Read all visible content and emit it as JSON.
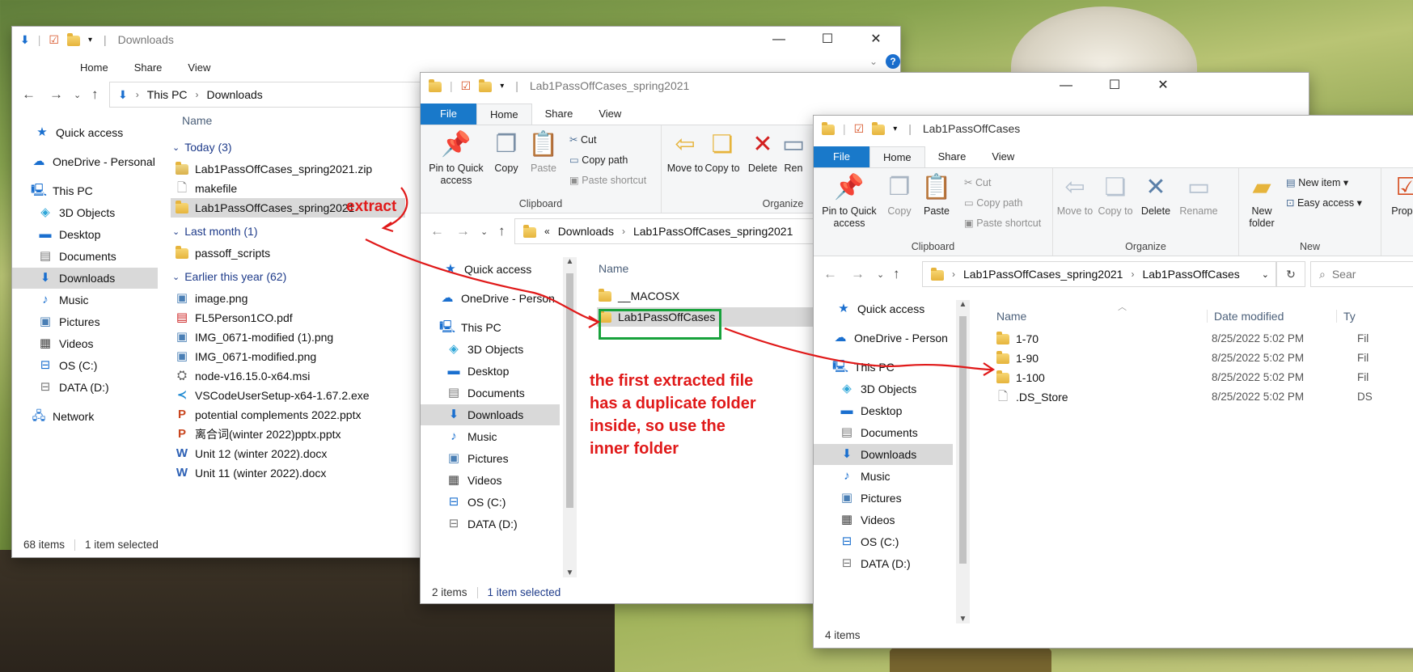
{
  "caption_controls": {
    "minimize": "—",
    "maximize": "☐",
    "close": "✕"
  },
  "win1": {
    "title": "Downloads",
    "tabs": [
      "Home",
      "Share",
      "View"
    ],
    "breadcrumb": [
      "This PC",
      "Downloads"
    ],
    "column_name": "Name",
    "nav": [
      {
        "label": "Quick access",
        "icon": "star-icon"
      },
      {
        "label": "OneDrive - Personal",
        "icon": "cloud-icon"
      },
      {
        "label": "This PC",
        "icon": "computer-icon"
      },
      {
        "label": "3D Objects",
        "icon": "cube-icon"
      },
      {
        "label": "Desktop",
        "icon": "desktop-icon"
      },
      {
        "label": "Documents",
        "icon": "document-icon"
      },
      {
        "label": "Downloads",
        "icon": "download-icon"
      },
      {
        "label": "Music",
        "icon": "music-icon"
      },
      {
        "label": "Pictures",
        "icon": "picture-icon"
      },
      {
        "label": "Videos",
        "icon": "video-icon"
      },
      {
        "label": "OS (C:)",
        "icon": "drive-icon"
      },
      {
        "label": "DATA (D:)",
        "icon": "drive-icon"
      },
      {
        "label": "Network",
        "icon": "network-icon"
      }
    ],
    "groups": [
      {
        "label": "Today (3)",
        "files": [
          "Lab1PassOffCases_spring2021.zip",
          "makefile",
          "Lab1PassOffCases_spring2021"
        ]
      },
      {
        "label": "Last month (1)",
        "files": [
          "passoff_scripts"
        ]
      },
      {
        "label": "Earlier this year (62)",
        "files": [
          "image.png",
          "FL5Person1CO.pdf",
          "IMG_0671-modified (1).png",
          "IMG_0671-modified.png",
          "node-v16.15.0-x64.msi",
          "VSCodeUserSetup-x64-1.67.2.exe",
          "potential complements 2022.pptx",
          "离合词(winter 2022)pptx.pptx",
          "Unit 12 (winter 2022).docx",
          "Unit 11 (winter 2022).docx"
        ]
      }
    ],
    "status": {
      "count": "68 items",
      "selected": "1 item selected"
    }
  },
  "win2": {
    "title": "Lab1PassOffCases_spring2021",
    "tabs": [
      "File",
      "Home",
      "Share",
      "View"
    ],
    "ribbon": {
      "pin": "Pin to Quick access",
      "copy": "Copy",
      "paste": "Paste",
      "cut": "Cut",
      "copy_path": "Copy path",
      "paste_shortcut": "Paste shortcut",
      "clipboard": "Clipboard",
      "move_to": "Move to",
      "copy_to": "Copy to",
      "delete": "Delete",
      "rename": "Ren",
      "organize": "Organize"
    },
    "breadcrumb": [
      "«",
      "Downloads",
      "Lab1PassOffCases_spring2021"
    ],
    "column_name": "Name",
    "nav": [
      {
        "label": "Quick access"
      },
      {
        "label": "OneDrive - Person"
      },
      {
        "label": "This PC"
      },
      {
        "label": "3D Objects"
      },
      {
        "label": "Desktop"
      },
      {
        "label": "Documents"
      },
      {
        "label": "Downloads"
      },
      {
        "label": "Music"
      },
      {
        "label": "Pictures"
      },
      {
        "label": "Videos"
      },
      {
        "label": "OS (C:)"
      },
      {
        "label": "DATA (D:)"
      }
    ],
    "files": [
      "__MACOSX",
      "Lab1PassOffCases"
    ],
    "status": {
      "count": "2 items",
      "selected": "1 item selected"
    }
  },
  "win3": {
    "title": "Lab1PassOffCases",
    "tabs": [
      "File",
      "Home",
      "Share",
      "View"
    ],
    "ribbon": {
      "pin": "Pin to Quick access",
      "copy": "Copy",
      "paste": "Paste",
      "cut": "Cut",
      "copy_path": "Copy path",
      "paste_shortcut": "Paste shortcut",
      "clipboard": "Clipboard",
      "move_to": "Move to",
      "copy_to": "Copy to",
      "delete": "Delete",
      "rename": "Rename",
      "organize": "Organize",
      "new_folder": "New folder",
      "new_item": "New item",
      "easy_access": "Easy access",
      "new": "New",
      "properties": "Proper"
    },
    "breadcrumb": [
      "Lab1PassOffCases_spring2021",
      "Lab1PassOffCases"
    ],
    "search_placeholder": "Sear",
    "columns": {
      "name": "Name",
      "modified": "Date modified",
      "type": "Ty"
    },
    "nav": [
      {
        "label": "Quick access"
      },
      {
        "label": "OneDrive - Person"
      },
      {
        "label": "This PC"
      },
      {
        "label": "3D Objects"
      },
      {
        "label": "Desktop"
      },
      {
        "label": "Documents"
      },
      {
        "label": "Downloads"
      },
      {
        "label": "Music"
      },
      {
        "label": "Pictures"
      },
      {
        "label": "Videos"
      },
      {
        "label": "OS (C:)"
      },
      {
        "label": "DATA (D:)"
      }
    ],
    "files": [
      {
        "name": "1-70",
        "modified": "8/25/2022 5:02 PM",
        "type": "Fil"
      },
      {
        "name": "1-90",
        "modified": "8/25/2022 5:02 PM",
        "type": "Fil"
      },
      {
        "name": "1-100",
        "modified": "8/25/2022 5:02 PM",
        "type": "Fil"
      },
      {
        "name": ".DS_Store",
        "modified": "8/25/2022 5:02 PM",
        "type": "DS"
      }
    ],
    "status": {
      "count": "4 items"
    }
  },
  "annotations": {
    "extract": "extract",
    "note": [
      "the first extracted file",
      "has a duplicate folder",
      "inside, so use the",
      "inner folder"
    ]
  },
  "colors": {
    "annotation": "#e01919",
    "highlight_box": "#18a23c",
    "accent": "#1979ca"
  }
}
